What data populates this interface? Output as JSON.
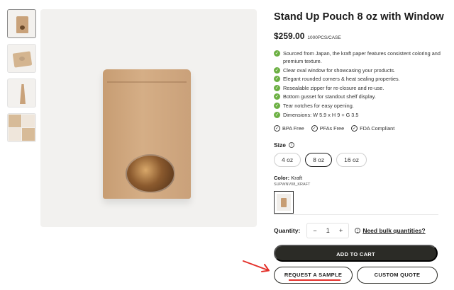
{
  "product": {
    "title": "Stand Up Pouch 8 oz with Window",
    "price": "$259.00",
    "unit": "1000PCS/CASE",
    "features": [
      "Sourced from Japan, the kraft paper features consistent coloring and premium texture.",
      "Clear oval window for showcasing your products.",
      "Elegant rounded corners & heat sealing properties.",
      "Resealable zipper for re-closure and re-use.",
      "Bottom gusset for standout shelf display.",
      "Tear notches for easy opening.",
      "Dimensions: W 5.9 x H 9 + G 3.5"
    ],
    "badges": [
      "BPA Free",
      "PFAs Free",
      "FDA Compliant"
    ]
  },
  "size": {
    "label": "Size",
    "options": [
      "4 oz",
      "8 oz",
      "16 oz"
    ],
    "selected": "8 oz"
  },
  "color": {
    "label": "Color:",
    "value": "Kraft",
    "sku": "SUPWNV08_KRAFT"
  },
  "quantity": {
    "label": "Quantity:",
    "value": "1",
    "minus": "−",
    "plus": "+",
    "bulk_link": "Need bulk quantities?"
  },
  "actions": {
    "add_to_cart": "ADD TO CART",
    "request_sample": "REQUEST A SAMPLE",
    "custom_quote": "CUSTOM QUOTE"
  },
  "icons": {
    "check": "✓",
    "info": "i",
    "badge_check": "✓"
  },
  "colors": {
    "accent_dark": "#2b2b26",
    "check_green": "#6cb043",
    "annotation_red": "#e4312b"
  }
}
